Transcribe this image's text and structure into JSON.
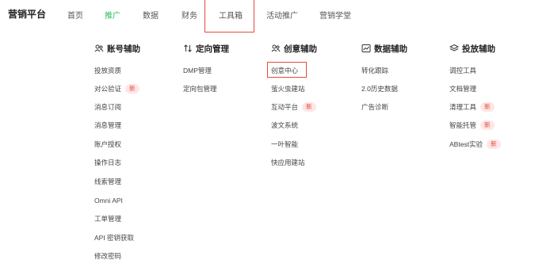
{
  "brand": "营销平台",
  "nav": [
    {
      "label": "首页"
    },
    {
      "label": "推广"
    },
    {
      "label": "数据"
    },
    {
      "label": "财务"
    },
    {
      "label": "工具箱"
    },
    {
      "label": "活动推广"
    },
    {
      "label": "营销学堂"
    }
  ],
  "colors": {
    "active_nav": "#2fbb5a",
    "highlight": "#e64a3b",
    "badge_bg": "#fde7e5"
  },
  "columns": [
    {
      "icon": "users-icon",
      "title": "账号辅助",
      "items": [
        {
          "label": "投放资质"
        },
        {
          "label": "对公验证",
          "badge": "新"
        },
        {
          "label": "消息订阅"
        },
        {
          "label": "消息管理"
        },
        {
          "label": "账户授权"
        },
        {
          "label": "操作日志"
        },
        {
          "label": "线索管理"
        },
        {
          "label": "Omni API"
        },
        {
          "label": "工单管理"
        },
        {
          "label": "API 密钥获取"
        },
        {
          "label": "修改密码"
        }
      ]
    },
    {
      "icon": "sort-icon",
      "title": "定向管理",
      "items": [
        {
          "label": "DMP管理"
        },
        {
          "label": "定向包管理"
        }
      ]
    },
    {
      "icon": "users-icon",
      "title": "创意辅助",
      "items": [
        {
          "label": "创意中心"
        },
        {
          "label": "萤火虫建站"
        },
        {
          "label": "互动平台",
          "badge": "新"
        },
        {
          "label": "波文系统"
        },
        {
          "label": "一叶智能"
        },
        {
          "label": "快应用建站"
        }
      ]
    },
    {
      "icon": "chart-icon",
      "title": "数据辅助",
      "items": [
        {
          "label": "转化跟踪"
        },
        {
          "label": "2.0历史数据"
        },
        {
          "label": "广告诊断"
        }
      ]
    },
    {
      "icon": "layers-icon",
      "title": "投放辅助",
      "items": [
        {
          "label": "调控工具"
        },
        {
          "label": "文档管理"
        },
        {
          "label": "清理工具",
          "badge": "新"
        },
        {
          "label": "智能托管",
          "badge": "新"
        },
        {
          "label": "ABtest实验",
          "badge": "新"
        }
      ]
    }
  ]
}
